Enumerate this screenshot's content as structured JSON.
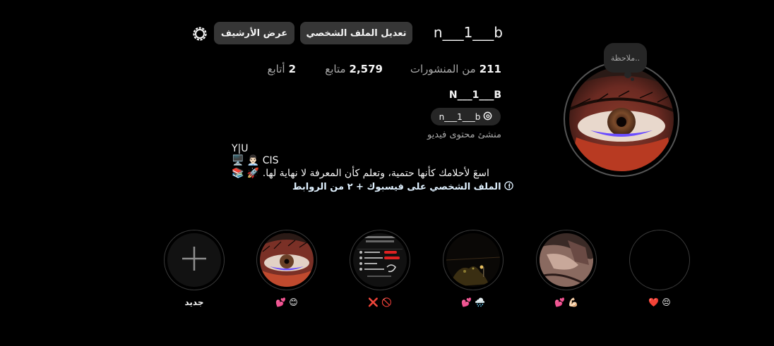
{
  "profile": {
    "username": "n___1___b",
    "note": "ملاحظة..",
    "edit_profile_label": "تعديل الملف الشخصي",
    "view_archive_label": "عرض الأرشيف",
    "posts_count": "211",
    "posts_label": "من المنشورات",
    "followers_count": "2,579",
    "followers_label": "متابع",
    "following_count": "2",
    "following_label": "أتابع",
    "full_name": "N___1___B",
    "threads_handle": "n___1___b",
    "category": "منشئ محتوى فيديو",
    "bio_line1": "Y|U",
    "bio_line2": "🖥️ 👨🏻‍💼 CIS",
    "bio_line3": "📚 🚀 .اسعَ لأحلامك كأنها حتمية، وتعلم كأن المعرفة لا نهاية لها",
    "link_text": "الملف الشخصي على فيسبوك + ٢ من الروابط"
  },
  "highlights": [
    {
      "label": "❤️ 😔"
    },
    {
      "label": "💕 💪🏻"
    },
    {
      "label": "💕 🌧️"
    },
    {
      "label": "❌ 🚫"
    },
    {
      "label": "💕 😊"
    },
    {
      "label": "جديد"
    }
  ],
  "colors": {
    "background": "#000000",
    "button": "#363636",
    "secondary_text": "#a8a8a8",
    "link": "#e0f1ff"
  }
}
